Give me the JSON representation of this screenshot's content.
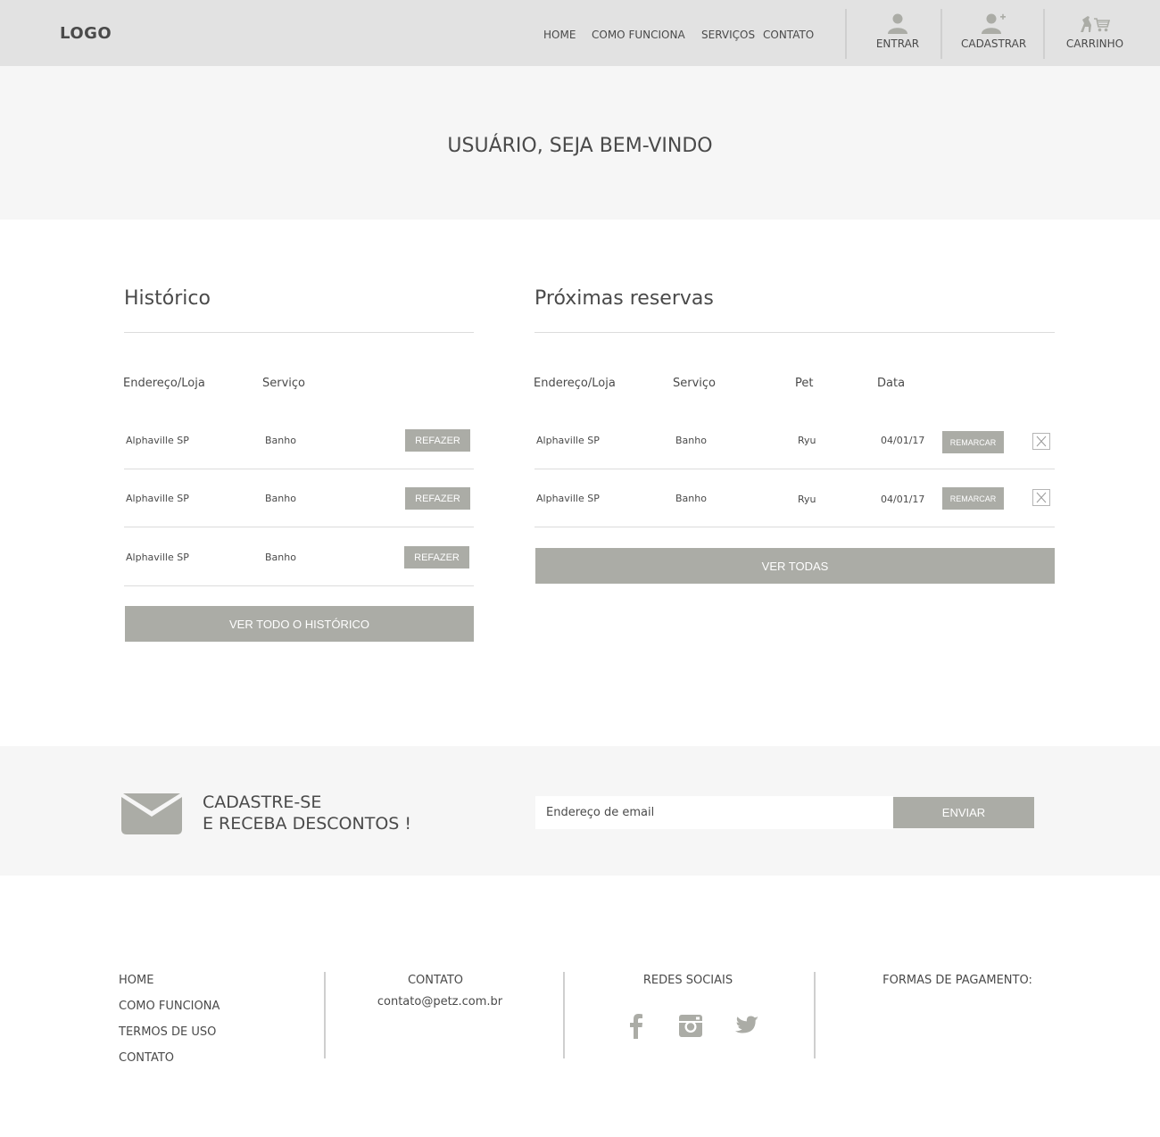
{
  "header": {
    "logo": "LOGO",
    "nav": [
      {
        "label": "HOME"
      },
      {
        "label": "COMO FUNCIONA"
      },
      {
        "label": "SERVIÇOS"
      },
      {
        "label": "CONTATO"
      }
    ],
    "actions": {
      "login": "ENTRAR",
      "register": "CADASTRAR",
      "cart": "CARRINHO"
    }
  },
  "hero": {
    "title": "USUÁRIO, SEJA BEM-VINDO"
  },
  "history": {
    "title": "Histórico",
    "columns": [
      "Endereço/Loja",
      "Serviço"
    ],
    "rows": [
      {
        "store": "Alphaville SP",
        "service": "Banho",
        "action": "REFAZER"
      },
      {
        "store": "Alphaville SP",
        "service": "Banho",
        "action": "REFAZER"
      },
      {
        "store": "Alphaville SP",
        "service": "Banho",
        "action": "REFAZER"
      }
    ],
    "view_all": "VER TODO O HISTÓRICO"
  },
  "bookings": {
    "title": "Próximas reservas",
    "columns": [
      "Endereço/Loja",
      "Serviço",
      "Pet",
      "Data"
    ],
    "rows": [
      {
        "store": "Alphaville SP",
        "service": "Banho",
        "pet": "Ryu",
        "date": "04/01/17",
        "action": "REMARCAR"
      },
      {
        "store": "Alphaville SP",
        "service": "Banho",
        "pet": "Ryu",
        "date": "04/01/17",
        "action": "REMARCAR"
      }
    ],
    "view_all": "VER TODAS"
  },
  "newsletter": {
    "line1": "CADASTRE-SE",
    "line2": "E RECEBA DESCONTOS !",
    "placeholder": "Endereço de email",
    "submit": "ENVIAR"
  },
  "footer": {
    "links": [
      "HOME",
      "COMO FUNCIONA",
      "TERMOS DE USO",
      "CONTATO"
    ],
    "contact_title": "CONTATO",
    "contact_email": "contato@petz.com.br",
    "social_title": "REDES SOCIAIS",
    "payment_title": "FORMAS DE PAGAMENTO:"
  },
  "colors": {
    "header_bg": "#e2e2e2",
    "section_bg": "#f6f6f6",
    "button_bg": "#abaca6",
    "text": "#4a4a4a"
  }
}
